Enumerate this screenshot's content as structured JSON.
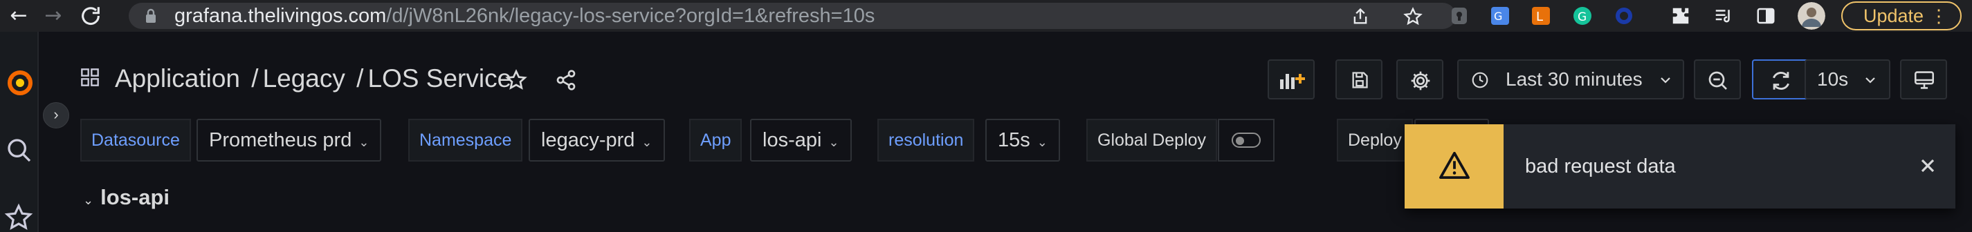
{
  "browser": {
    "url_host": "grafana.thelivingos.com",
    "url_path": "/d/jW8nL26nk/legacy-los-service?orgId=1&refresh=10s",
    "update_label": "Update",
    "update_menu": "⋮",
    "icons": [
      "back-icon",
      "forward-icon",
      "reload-icon",
      "lock-icon",
      "share-page-icon",
      "bookmark-star-icon",
      "extensions-icon",
      "reading-list-icon",
      "side-panel-icon",
      "profile-avatar"
    ]
  },
  "header": {
    "breadcrumb": [
      "Application",
      "Legacy",
      "LOS Service"
    ],
    "separator": "/"
  },
  "toolbar": {
    "time_range": "Last 30 minutes",
    "refresh_interval": "10s"
  },
  "variables": [
    {
      "label": "Datasource",
      "value": "Prometheus prd"
    },
    {
      "label": "Namespace",
      "value": "legacy-prd"
    },
    {
      "label": "App",
      "value": "los-api"
    },
    {
      "label": "resolution",
      "value": "15s"
    },
    {
      "label": "Global Deploy",
      "value": ""
    },
    {
      "label": "Deploy",
      "value": ""
    }
  ],
  "row": {
    "title": "los-api"
  },
  "toast": {
    "message": "bad request data",
    "type": "warning"
  },
  "colors": {
    "background": "#111217",
    "link_blue": "#6e9fff",
    "warning": "#e8b94e",
    "grafana_orange": "#f46800",
    "update_yellow": "#f0c36a"
  }
}
